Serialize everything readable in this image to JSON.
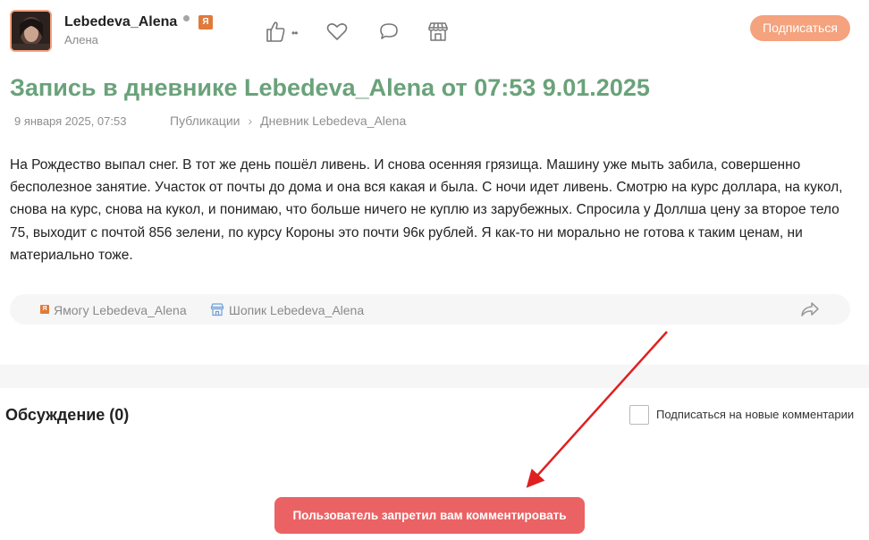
{
  "header": {
    "username": "Lebedeva_Alena",
    "subname": "Алена",
    "badge": "Я",
    "like_count": "••",
    "subscribe_label": "Подписаться"
  },
  "post": {
    "title": "Запись в дневнике Lebedeva_Alena от 07:53 9.01.2025",
    "date": "9 января 2025, 07:53",
    "breadcrumb": [
      "Публикации",
      "Дневник Lebedeva_Alena"
    ],
    "breadcrumb_sep": "›",
    "text": "На Рождество выпал снег. В тот же день пошёл ливень. И снова осенняя грязища. Машину уже мыть забила, совершенно бесполезное занятие. Участок от почты до дома и она вся какая и была. С ночи идет ливень. Смотрю на курс доллара, на кукол, снова на курс, снова на кукол, и понимаю, что больше ничего не куплю из зарубежных. Спросила у Доллша цену за второе тело 75, выходит с почтой 856 зелени, по курсу Короны это почти 96к рублей. Я как-то ни морально не готова к таким ценам, ни материально тоже."
  },
  "tags": {
    "ya_icon_text": "Я",
    "yamogu": "Ямогу Lebedeva_Alena",
    "shopik": "Шопик Lebedeva_Alena"
  },
  "discussion": {
    "title": "Обсуждение (0)",
    "subscribe_comments_label": "Подписаться на новые комментарии",
    "blocked_label": "Пользователь запретил вам комментировать"
  },
  "colors": {
    "accent_green": "#6aa27a",
    "subscribe_orange": "#f5a27e",
    "blocked_red": "#eb6264",
    "annotation_arrow": "#e02020"
  },
  "icons": [
    "thumbs-up-icon",
    "heart-icon",
    "comment-icon",
    "store-icon",
    "share-icon"
  ]
}
